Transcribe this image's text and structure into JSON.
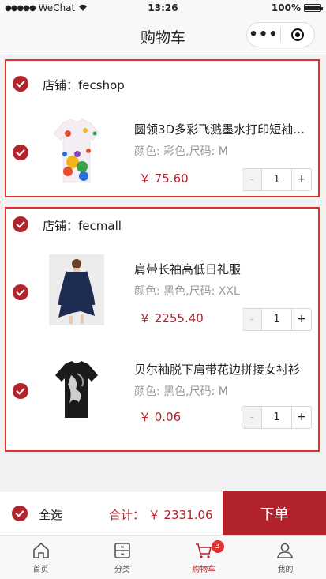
{
  "status_bar": {
    "carrier": "WeChat",
    "time": "13:26",
    "battery": "100%"
  },
  "nav": {
    "title": "购物车",
    "more_icon": "more-dots-icon",
    "close_icon": "record-circle-icon"
  },
  "shops": [
    {
      "name_label": "店铺：",
      "name": "fecshop",
      "checked": true,
      "items": [
        {
          "title": "圆领3D多彩飞溅墨水打印短袖男...",
          "attrs": "颜色: 彩色,尺码: M",
          "price": "￥ 75.60",
          "qty": "1",
          "checked": true,
          "image": "colorful-splash-tshirt"
        }
      ]
    },
    {
      "name_label": "店铺：",
      "name": "fecmall",
      "checked": true,
      "items": [
        {
          "title": "肩带长袖高低日礼服",
          "attrs": "颜色: 黑色,尺码: XXL",
          "price": "￥ 2255.40",
          "qty": "1",
          "checked": true,
          "image": "navy-long-sleeve-dress"
        },
        {
          "title": "贝尔袖脱下肩带花边拼接女衬衫",
          "attrs": "颜色: 黑色,尺码: M",
          "price": "￥ 0.06",
          "qty": "1",
          "checked": true,
          "image": "black-print-tshirt"
        }
      ]
    }
  ],
  "stepper": {
    "minus": "-",
    "plus": "+"
  },
  "footer": {
    "select_all": "全选",
    "total": "合计： ￥ 2331.06",
    "order_button": "下单"
  },
  "tabbar": [
    {
      "label": "首页",
      "icon": "home-icon",
      "active": false
    },
    {
      "label": "分类",
      "icon": "category-icon",
      "active": false
    },
    {
      "label": "购物车",
      "icon": "cart-icon",
      "active": true,
      "badge": "3"
    },
    {
      "label": "我的",
      "icon": "user-icon",
      "active": false
    }
  ],
  "colors": {
    "accent": "#b3232c",
    "highlight_border": "#e03030",
    "badge": "#e03030"
  }
}
